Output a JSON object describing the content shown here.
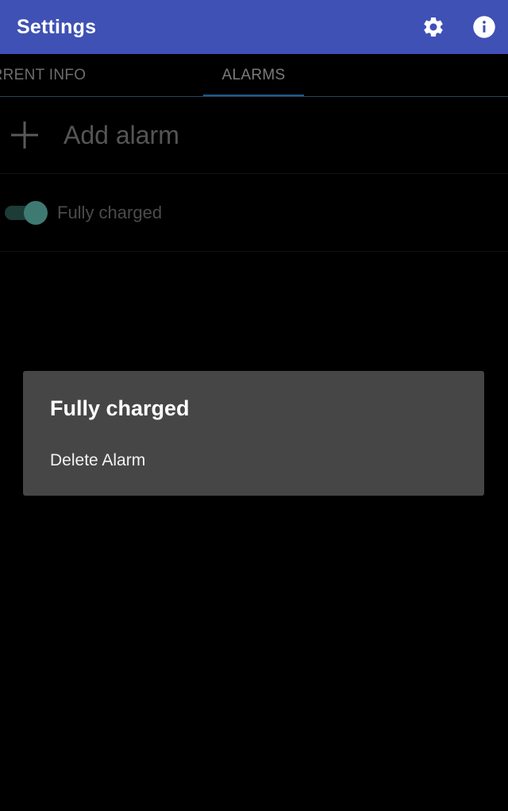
{
  "appbar": {
    "title": "Settings",
    "settings_icon": "gear-icon",
    "info_icon": "info-icon",
    "color": "#3f51b5"
  },
  "tabs": [
    {
      "label": "CURRENT INFO",
      "visible_label": "URRENT INFO",
      "selected": false
    },
    {
      "label": "ALARMS",
      "selected": true
    }
  ],
  "list": {
    "add_label": "Add alarm",
    "add_icon": "plus-icon",
    "alarms": [
      {
        "label": "Fully charged",
        "enabled": true
      }
    ]
  },
  "dialog": {
    "title": "Fully charged",
    "items": [
      {
        "label": "Delete Alarm"
      }
    ]
  }
}
